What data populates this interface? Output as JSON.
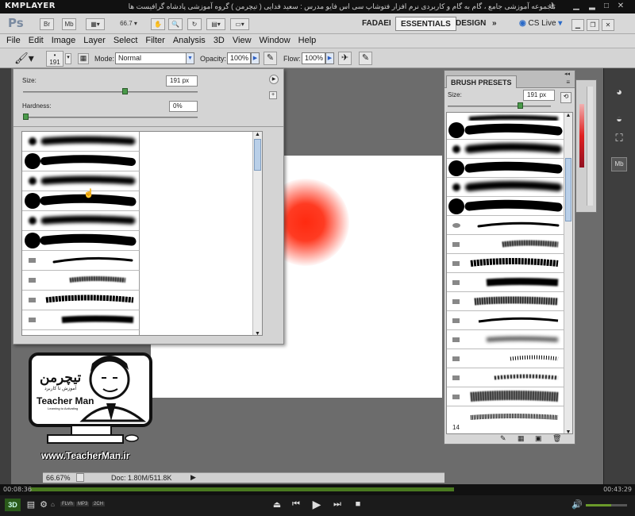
{
  "player": {
    "logo": "KMPLAYER",
    "title": "مجموعه آموزشی جامع ، گام به گام و کاربردی نرم افزار فتوشاپ سی اس فایو   مدرس : سعید فدایی ( تیچرمن ) گروه آموزشی پادشاه گرافیست ها",
    "time_elapsed": "00:08:36",
    "time_total": "00:43:29",
    "badges": [
      "FLVh",
      "MP3",
      "2CH"
    ],
    "progress": 0.76
  },
  "photoshop": {
    "app_icon": "Ps",
    "top_buttons": [
      "Br",
      "Mb"
    ],
    "zoom_field": "66.7",
    "workspaces": [
      "FADAEI",
      "ESSENTIALS",
      "DESIGN"
    ],
    "active_workspace": "ESSENTIALS",
    "cs_live": "CS Live",
    "menu": [
      "File",
      "Edit",
      "Image",
      "Layer",
      "Select",
      "Filter",
      "Analysis",
      "3D",
      "View",
      "Window",
      "Help"
    ],
    "options": {
      "brush_size_number": "191",
      "mode_label": "Mode:",
      "mode_value": "Normal",
      "opacity_label": "Opacity:",
      "opacity_value": "100%",
      "flow_label": "Flow:",
      "flow_value": "100%"
    },
    "picker": {
      "size_label": "Size:",
      "size_value": "191 px",
      "size_slider": 0.58,
      "hardness_label": "Hardness:",
      "hardness_value": "0%",
      "hardness_slider": 0
    },
    "brush_presets": {
      "tab": "BRUSH PRESETS",
      "size_label": "Size:",
      "size_value": "191 px",
      "size_slider": 0.68,
      "last_number": "14"
    },
    "status": {
      "zoom": "66.67%",
      "doc": "Doc: 1.80M/511.8K"
    },
    "colors": {
      "ps_bg": "#6c6c6c",
      "red_dot": "#ff2a10"
    }
  },
  "overlay": {
    "brand_fa": "تیچرمن",
    "brand_fa_sub": "آموزش تا کاربرد",
    "brand_en": "Teacher Man",
    "tagline": "Learning to Activating",
    "url": "www.TeacherMan.ir"
  }
}
